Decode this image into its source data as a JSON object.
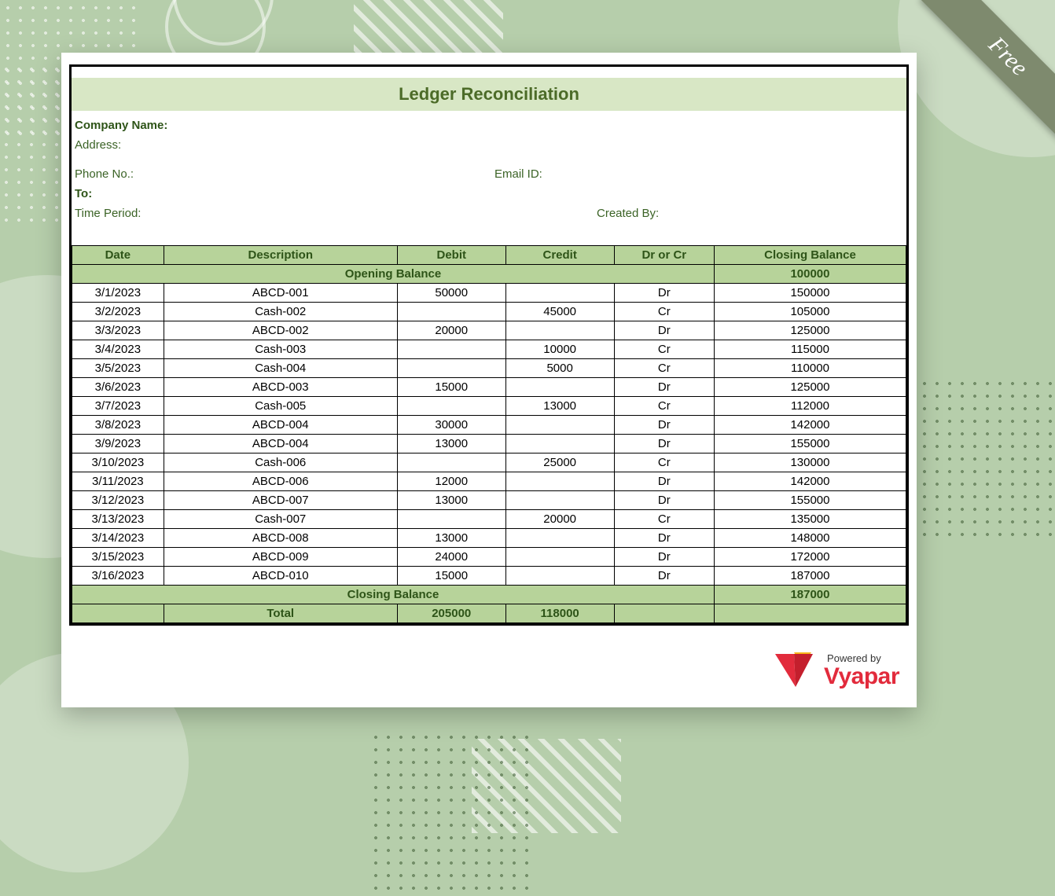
{
  "ribbon": "Free",
  "title": "Ledger Reconciliation",
  "info": {
    "company_name_label": "Company Name:",
    "address_label": "Address:",
    "phone_label": "Phone No.:",
    "email_label": "Email ID:",
    "to_label": "To:",
    "time_period_label": "Time Period:",
    "created_by_label": "Created By:"
  },
  "headers": {
    "date": "Date",
    "description": "Description",
    "debit": "Debit",
    "credit": "Credit",
    "drcr": "Dr or Cr",
    "closing": "Closing Balance"
  },
  "opening": {
    "label": "Opening Balance",
    "value": "100000"
  },
  "rows": [
    {
      "date": "3/1/2023",
      "desc": "ABCD-001",
      "debit": "50000",
      "credit": "",
      "drcr": "Dr",
      "close": "150000"
    },
    {
      "date": "3/2/2023",
      "desc": "Cash-002",
      "debit": "",
      "credit": "45000",
      "drcr": "Cr",
      "close": "105000"
    },
    {
      "date": "3/3/2023",
      "desc": "ABCD-002",
      "debit": "20000",
      "credit": "",
      "drcr": "Dr",
      "close": "125000"
    },
    {
      "date": "3/4/2023",
      "desc": "Cash-003",
      "debit": "",
      "credit": "10000",
      "drcr": "Cr",
      "close": "115000"
    },
    {
      "date": "3/5/2023",
      "desc": "Cash-004",
      "debit": "",
      "credit": "5000",
      "drcr": "Cr",
      "close": "110000"
    },
    {
      "date": "3/6/2023",
      "desc": "ABCD-003",
      "debit": "15000",
      "credit": "",
      "drcr": "Dr",
      "close": "125000"
    },
    {
      "date": "3/7/2023",
      "desc": "Cash-005",
      "debit": "",
      "credit": "13000",
      "drcr": "Cr",
      "close": "112000"
    },
    {
      "date": "3/8/2023",
      "desc": "ABCD-004",
      "debit": "30000",
      "credit": "",
      "drcr": "Dr",
      "close": "142000"
    },
    {
      "date": "3/9/2023",
      "desc": "ABCD-004",
      "debit": "13000",
      "credit": "",
      "drcr": "Dr",
      "close": "155000"
    },
    {
      "date": "3/10/2023",
      "desc": "Cash-006",
      "debit": "",
      "credit": "25000",
      "drcr": "Cr",
      "close": "130000"
    },
    {
      "date": "3/11/2023",
      "desc": "ABCD-006",
      "debit": "12000",
      "credit": "",
      "drcr": "Dr",
      "close": "142000"
    },
    {
      "date": "3/12/2023",
      "desc": "ABCD-007",
      "debit": "13000",
      "credit": "",
      "drcr": "Dr",
      "close": "155000"
    },
    {
      "date": "3/13/2023",
      "desc": "Cash-007",
      "debit": "",
      "credit": "20000",
      "drcr": "Cr",
      "close": "135000"
    },
    {
      "date": "3/14/2023",
      "desc": "ABCD-008",
      "debit": "13000",
      "credit": "",
      "drcr": "Dr",
      "close": "148000"
    },
    {
      "date": "3/15/2023",
      "desc": "ABCD-009",
      "debit": "24000",
      "credit": "",
      "drcr": "Dr",
      "close": "172000"
    },
    {
      "date": "3/16/2023",
      "desc": "ABCD-010",
      "debit": "15000",
      "credit": "",
      "drcr": "Dr",
      "close": "187000"
    }
  ],
  "closing": {
    "label": "Closing Balance",
    "value": "187000"
  },
  "total": {
    "label": "Total",
    "debit": "205000",
    "credit": "118000"
  },
  "logo": {
    "powered_by": "Powered by",
    "name": "Vyapar"
  }
}
